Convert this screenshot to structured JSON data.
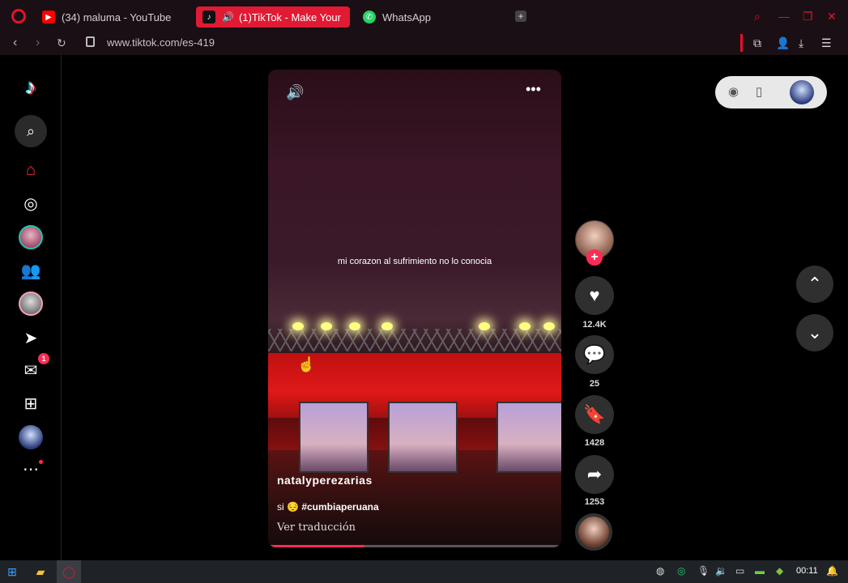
{
  "browser": {
    "tabs": [
      {
        "label": "(34) maluma - YouTube"
      },
      {
        "label": "(1)TikTok - Make Your"
      },
      {
        "label": "WhatsApp"
      }
    ],
    "url": "www.tiktok.com/es-419"
  },
  "sidebar": {
    "notification_badge": "1"
  },
  "video": {
    "caption": "mi corazon al sufrimiento no lo conocia",
    "author": "natalyperezarias",
    "description_prefix": "si",
    "description_emoji": "😔",
    "hashtag": "#cumbiaperuana",
    "translate_label": "Ver traducción",
    "progress": 0.33
  },
  "actions": {
    "likes": "12.4K",
    "comments": "25",
    "saves": "1428",
    "shares": "1253"
  },
  "taskbar": {
    "time": "00:11"
  },
  "colors": {
    "accent": "#fe2c55",
    "opera_red": "#e8102a"
  }
}
